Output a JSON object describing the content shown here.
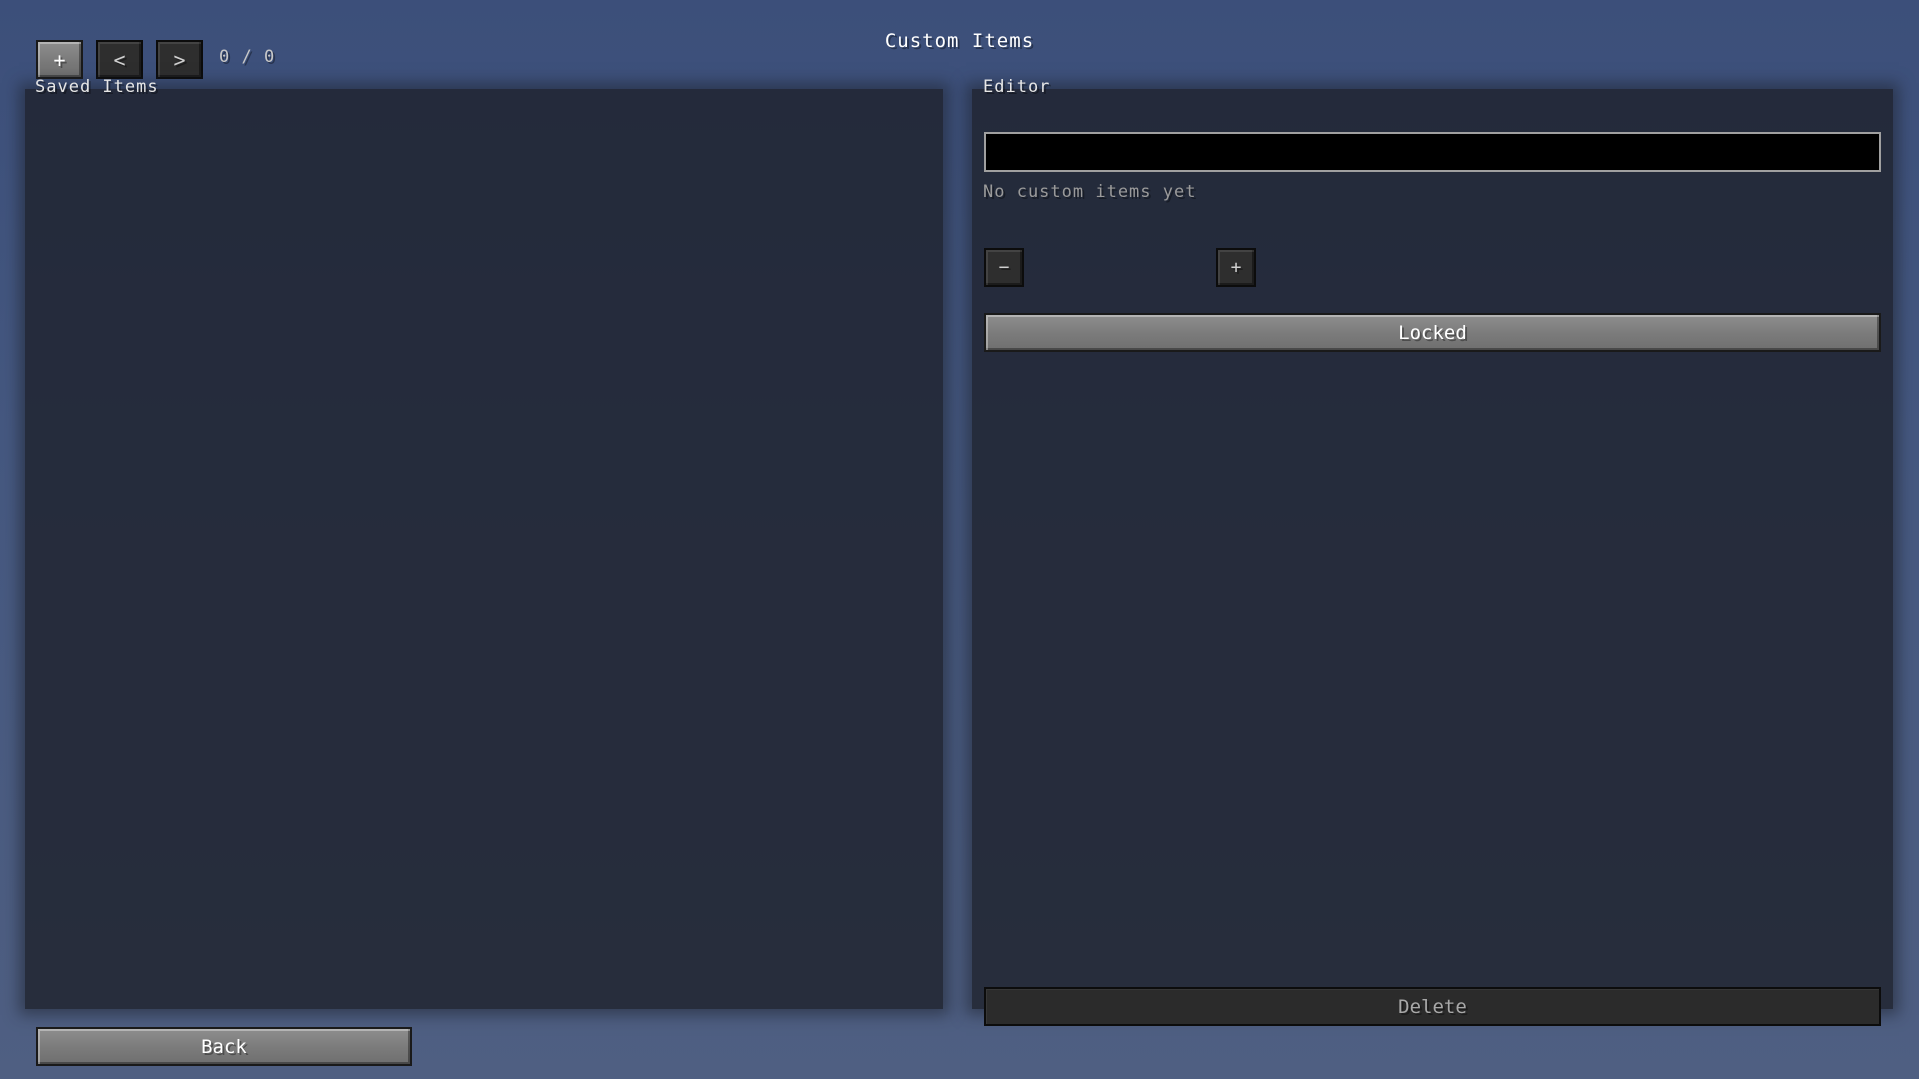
{
  "header": {
    "title": "Custom Items"
  },
  "toolbar": {
    "add_label": "+",
    "prev_label": "<",
    "next_label": ">",
    "page_counter": "0 / 0"
  },
  "saved_items": {
    "label": "Saved Items",
    "items": []
  },
  "editor": {
    "label": "Editor",
    "name_input": {
      "value": "",
      "placeholder": ""
    },
    "empty_hint": "No custom items yet",
    "decrease_label": "−",
    "increase_label": "+",
    "lock_label": "Locked",
    "delete_label": "Delete"
  },
  "footer": {
    "back_label": "Back"
  }
}
